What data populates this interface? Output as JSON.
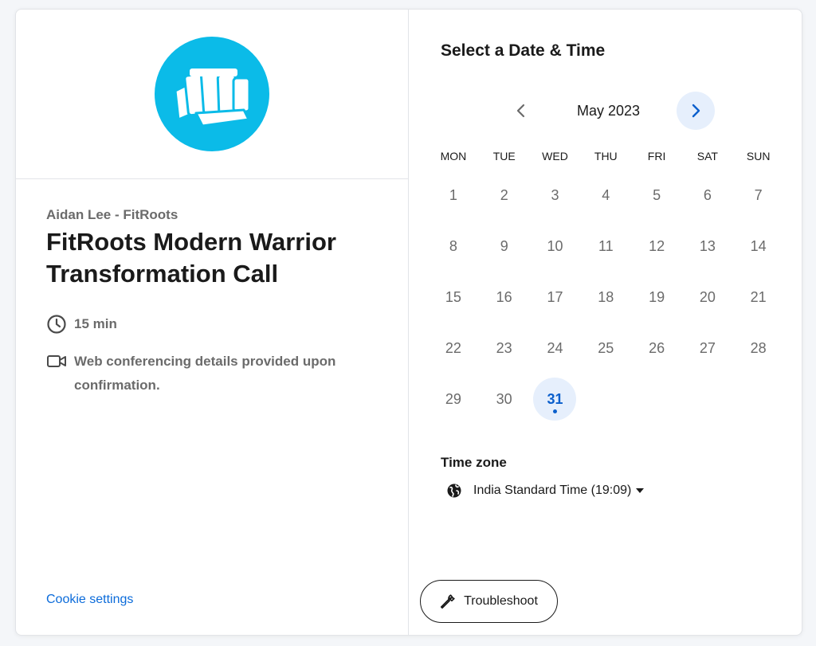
{
  "event": {
    "organizer": "Aidan Lee - FitRoots",
    "title": "FitRoots Modern Warrior Transformation Call",
    "duration": "15 min",
    "conferencing": "Web conferencing details provided upon confirmation.",
    "brand_color": "#0bbbe8"
  },
  "footer": {
    "cookie_settings": "Cookie settings"
  },
  "scheduler": {
    "title": "Select a Date & Time",
    "month": "May 2023",
    "weekdays": [
      "MON",
      "TUE",
      "WED",
      "THU",
      "FRI",
      "SAT",
      "SUN"
    ],
    "days": [
      "1",
      "2",
      "3",
      "4",
      "5",
      "6",
      "7",
      "8",
      "9",
      "10",
      "11",
      "12",
      "13",
      "14",
      "15",
      "16",
      "17",
      "18",
      "19",
      "20",
      "21",
      "22",
      "23",
      "24",
      "25",
      "26",
      "27",
      "28",
      "29",
      "30",
      "31"
    ],
    "available_day": "31",
    "accent_color": "#0b5fcc",
    "timezone_label": "Time zone",
    "timezone_value": "India Standard Time (19:09)",
    "troubleshoot": "Troubleshoot"
  },
  "icons": {
    "logo": "fist-logo-icon",
    "duration": "clock-icon",
    "conferencing": "video-camera-icon",
    "prev": "chevron-left-icon",
    "next": "chevron-right-icon",
    "timezone": "globe-icon",
    "timezone_caret": "caret-down-icon",
    "troubleshoot": "wrench-icon"
  }
}
